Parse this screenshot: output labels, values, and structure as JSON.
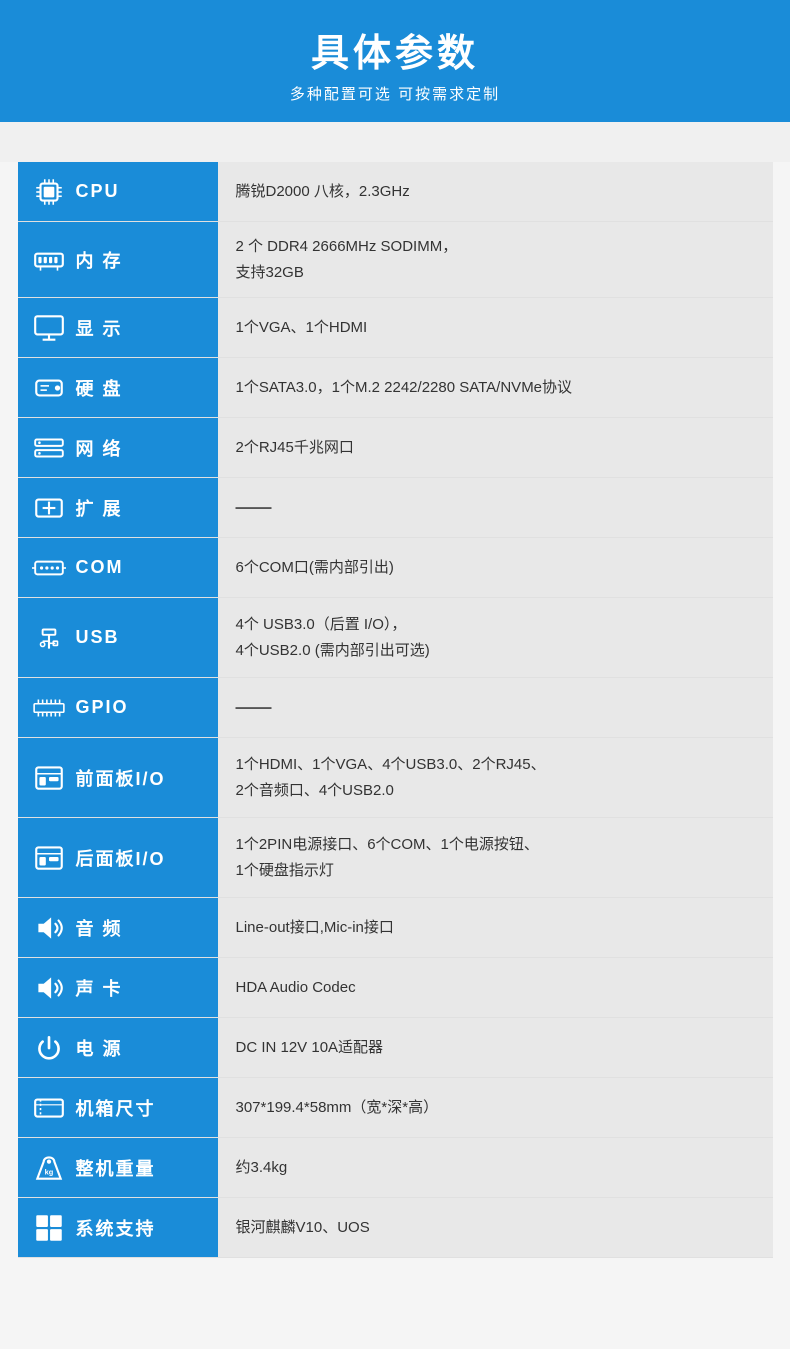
{
  "header": {
    "title": "具体参数",
    "subtitle": "多种配置可选 可按需求定制"
  },
  "rows": [
    {
      "id": "cpu",
      "label": "CPU",
      "icon": "🖥",
      "value": "腾锐D2000 八核，2.3GHz",
      "multiline": false
    },
    {
      "id": "memory",
      "label": "内 存",
      "icon": "📋",
      "value": "2 个 DDR4 2666MHz SODIMM，\n支持32GB",
      "multiline": true
    },
    {
      "id": "display",
      "label": "显 示",
      "icon": "🖥",
      "value": "1个VGA、1个HDMI",
      "multiline": false
    },
    {
      "id": "hdd",
      "label": "硬 盘",
      "icon": "💾",
      "value": "1个SATA3.0，1个M.2 2242/2280 SATA/NVMe协议",
      "multiline": false
    },
    {
      "id": "network",
      "label": "网 络",
      "icon": "🌐",
      "value": "2个RJ45千兆网口",
      "multiline": false
    },
    {
      "id": "expand",
      "label": "扩 展",
      "icon": "📡",
      "value": "——",
      "multiline": false
    },
    {
      "id": "com",
      "label": "COM",
      "icon": "🔌",
      "value": "6个COM口(需内部引出)",
      "multiline": false
    },
    {
      "id": "usb",
      "label": "USB",
      "icon": "🔗",
      "value": "4个 USB3.0（后置 I/O），\n4个USB2.0 (需内部引出可选)",
      "multiline": true
    },
    {
      "id": "gpio",
      "label": "GPIO",
      "icon": "📟",
      "value": "——",
      "multiline": false
    },
    {
      "id": "front-io",
      "label": "前面板I/O",
      "icon": "🗂",
      "value": "1个HDMI、1个VGA、4个USB3.0、2个RJ45、\n2个音频口、4个USB2.0",
      "multiline": true
    },
    {
      "id": "rear-io",
      "label": "后面板I/O",
      "icon": "🗂",
      "value": "1个2PIN电源接口、6个COM、1个电源按钮、\n1个硬盘指示灯",
      "multiline": true
    },
    {
      "id": "audio",
      "label": "音 频",
      "icon": "🔊",
      "value": "Line-out接口,Mic-in接口",
      "multiline": false
    },
    {
      "id": "soundcard",
      "label": "声 卡",
      "icon": "🔊",
      "value": "HDA Audio Codec",
      "multiline": false
    },
    {
      "id": "power",
      "label": "电 源",
      "icon": "⚡",
      "value": "DC IN 12V 10A适配器",
      "multiline": false
    },
    {
      "id": "chassis",
      "label": "机箱尺寸",
      "icon": "📐",
      "value": "307*199.4*58mm（宽*深*高）",
      "multiline": false
    },
    {
      "id": "weight",
      "label": "整机重量",
      "icon": "⚖",
      "value": "约3.4kg",
      "multiline": false
    },
    {
      "id": "os",
      "label": "系统支持",
      "icon": "🪟",
      "value": "银河麒麟V10、UOS",
      "multiline": false
    }
  ],
  "icons": {
    "cpu": "cpu-icon",
    "memory": "ram-icon",
    "display": "display-icon",
    "hdd": "hdd-icon",
    "network": "network-icon",
    "expand": "expand-icon",
    "com": "com-icon",
    "usb": "usb-icon",
    "gpio": "gpio-icon",
    "front-io": "front-io-icon",
    "rear-io": "rear-io-icon",
    "audio": "audio-icon",
    "soundcard": "soundcard-icon",
    "power": "power-icon",
    "chassis": "chassis-icon",
    "weight": "weight-icon",
    "os": "os-icon"
  }
}
